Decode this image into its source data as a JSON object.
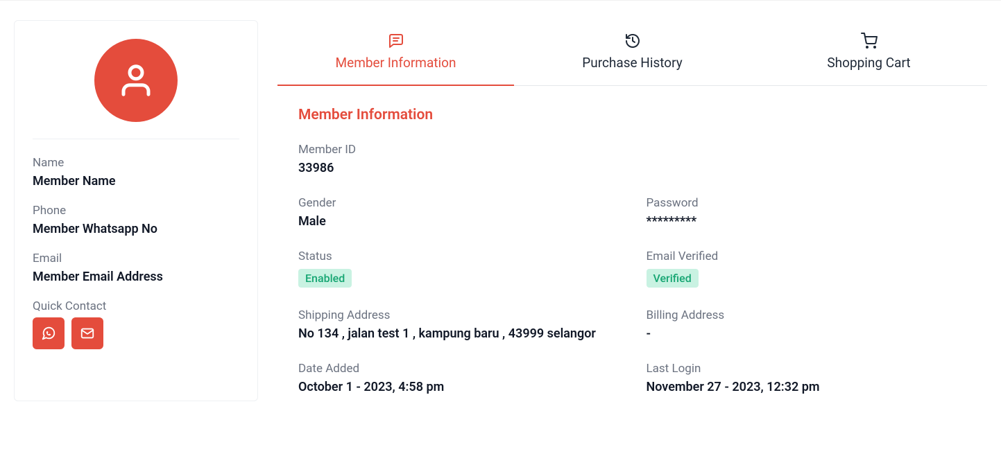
{
  "colors": {
    "accent": "#e44c3c",
    "badge_bg": "#c9f2e2",
    "badge_fg": "#17a673"
  },
  "sidebar": {
    "name_label": "Name",
    "name_value": "Member Name",
    "phone_label": "Phone",
    "phone_value": "Member Whatsapp No",
    "email_label": "Email",
    "email_value": "Member Email Address",
    "quick_contact_label": "Quick Contact"
  },
  "tabs": {
    "member_info": "Member Information",
    "purchase_history": "Purchase History",
    "shopping_cart": "Shopping Cart"
  },
  "section": {
    "title": "Member Information",
    "member_id_label": "Member ID",
    "member_id_value": "33986",
    "gender_label": "Gender",
    "gender_value": "Male",
    "password_label": "Password",
    "password_value": "*********",
    "status_label": "Status",
    "status_value": "Enabled",
    "email_verified_label": "Email Verified",
    "email_verified_value": "Verified",
    "shipping_label": "Shipping Address",
    "shipping_value": "No 134 , jalan test 1 , kampung baru , 43999 selangor",
    "billing_label": "Billing Address",
    "billing_value": "-",
    "date_added_label": "Date Added",
    "date_added_value": "October 1 - 2023, 4:58 pm",
    "last_login_label": "Last Login",
    "last_login_value": "November 27 - 2023, 12:32 pm"
  }
}
